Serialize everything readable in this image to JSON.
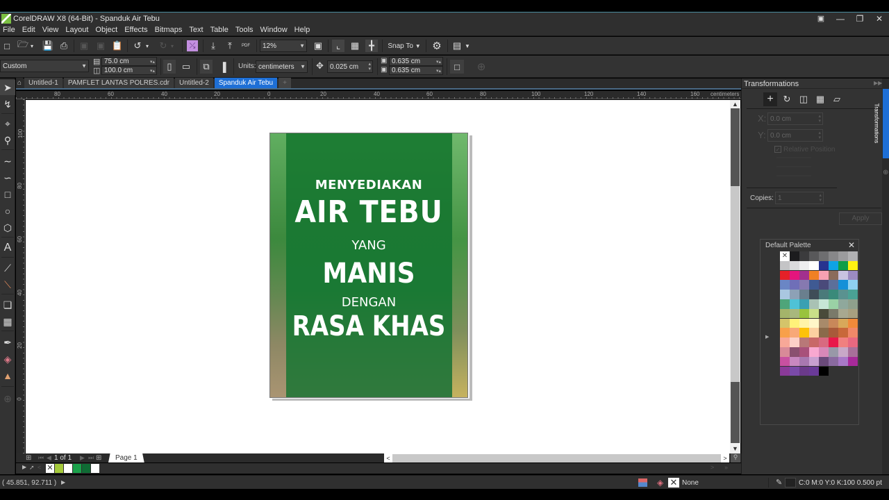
{
  "window": {
    "title": "CorelDRAW X8 (64-Bit) - Spanduk Air Tebu",
    "controls": [
      "account-icon",
      "minimize",
      "restore",
      "close"
    ]
  },
  "menu": [
    "File",
    "Edit",
    "View",
    "Layout",
    "Object",
    "Effects",
    "Bitmaps",
    "Text",
    "Table",
    "Tools",
    "Window",
    "Help"
  ],
  "toolbar": {
    "zoom_value": "12%",
    "snap_to_label": "Snap To",
    "pdf_label": "PDF"
  },
  "property_bar": {
    "page_size": "Custom",
    "width": "75.0 cm",
    "height": "100.0 cm",
    "units_label": "Units:",
    "units_value": "centimeters",
    "nudge": "0.025 cm",
    "dup_x": "0.635 cm",
    "dup_y": "0.635 cm"
  },
  "tabs": [
    {
      "label": "Untitled-1",
      "active": false
    },
    {
      "label": "PAMFLET LANTAS POLRES.cdr",
      "active": false
    },
    {
      "label": "Untitled-2",
      "active": false
    },
    {
      "label": "Spanduk Air Tebu",
      "active": true
    }
  ],
  "ruler": {
    "h_ticks": [
      "80",
      "60",
      "40",
      "20",
      "0",
      "20",
      "40",
      "60",
      "80",
      "100",
      "120",
      "140",
      "160"
    ],
    "units": "centimeters",
    "v_ticks": [
      "100",
      "80",
      "60",
      "40",
      "20",
      "0"
    ]
  },
  "poster": {
    "line1": "MENYEDIAKAN",
    "line2": "AIR TEBU",
    "line3": "YANG",
    "line4": "MANIS",
    "line5": "DENGAN",
    "line6": "RASA KHAS",
    "overlay_color": "#1e7a3c"
  },
  "page_nav": {
    "counter": "1 of 1",
    "page_tab": "Page 1"
  },
  "doc_palette": [
    "none",
    "#a4c93a",
    "#ffffff",
    "#1aa04a",
    "#0f6b34",
    "#ffffff"
  ],
  "status": {
    "coords": "( 45.851, 92.711 )",
    "fill_label": "None",
    "outline_info": "C:0 M:0 Y:0 K:100  0.500 pt"
  },
  "transformations": {
    "title": "Transformations",
    "x_label": "X:",
    "x_value": "0.0 cm",
    "y_label": "Y:",
    "y_value": "0.0 cm",
    "relative_position": "Relative Position",
    "copies_label": "Copies:",
    "copies_value": "1",
    "apply_label": "Apply",
    "docker_tab_label": "Transformations"
  },
  "default_palette": {
    "title": "Default Palette",
    "colors": [
      "none",
      "#1c1c1e",
      "#3b3b3d",
      "#58585a",
      "#6e6e70",
      "#878789",
      "#9b9b9d",
      "#b1b1b3",
      "#c4c4c6",
      "#dadadc",
      "#ededef",
      "#ffffff",
      "#27338f",
      "#0ea3e4",
      "#0f9d48",
      "#fff212",
      "#e42128",
      "#e4157d",
      "#a2308e",
      "#f08024",
      "#f6a1b1",
      "#8b6b5b",
      "#c8c2e1",
      "#9b8bc2",
      "#6a86c5",
      "#6f6fb8",
      "#8679b0",
      "#3f5a93",
      "#4a4a7a",
      "#5c6f9a",
      "#1490d8",
      "#8fd1f1",
      "#a9c7e1",
      "#8da1b6",
      "#6a7f8e",
      "#3f4d58",
      "#4a7a7a",
      "#3a8a7a",
      "#5a9290",
      "#4aa295",
      "#4ea57a",
      "#4fc2d6",
      "#3aa0b2",
      "#a9c2b4",
      "#c7e6d6",
      "#9ad1a5",
      "#8fa89c",
      "#8fa08c",
      "#a4b46a",
      "#a8b87d",
      "#99c33d",
      "#c9df88",
      "#4a4a3a",
      "#7a7a6a",
      "#a8a890",
      "#a8a080",
      "#d4c46a",
      "#fff27a",
      "#fff4a8",
      "#fff6c8",
      "#a88a6a",
      "#c8885a",
      "#d8a85a",
      "#f08a3a",
      "#f8a04a",
      "#f8a878",
      "#fdc20a",
      "#fcd0a0",
      "#8a6a4a",
      "#a85a3a",
      "#c8683a",
      "#f08868",
      "#f8a898",
      "#fcd0c8",
      "#b87878",
      "#c86868",
      "#d86a80",
      "#e8184a",
      "#f08080",
      "#e86880",
      "#d88a98",
      "#8a5070",
      "#a8507a",
      "#f8a8d0",
      "#d888b8",
      "#9898a8",
      "#c8a8c8",
      "#a8709a",
      "#c850a0",
      "#c888c0",
      "#a878b0",
      "#c8a0d0",
      "#6a4a7a",
      "#8a6aa0",
      "#a878c8",
      "#a82a9a",
      "#8a3a98",
      "#7a4aa8",
      "#6a3a8a",
      "#6a3a98",
      "#000000"
    ]
  }
}
